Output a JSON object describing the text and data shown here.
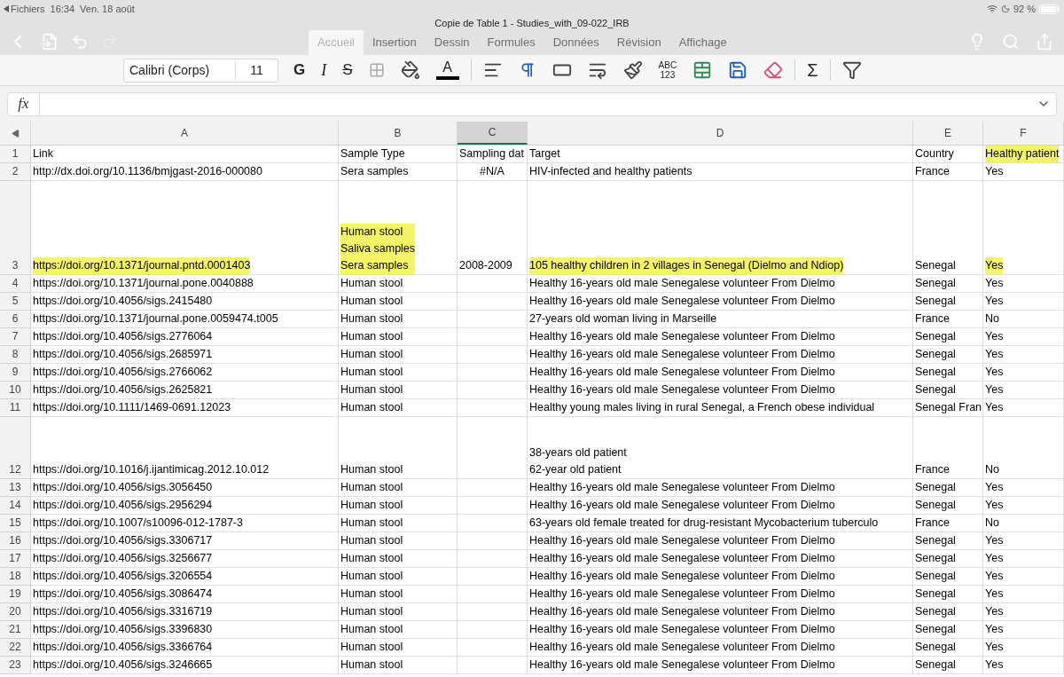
{
  "status_bar": {
    "back_label": "Fichiers",
    "time": "16:34",
    "date": "Ven. 18 août",
    "battery": "92 %"
  },
  "window": {
    "title": "Copie de Table 1 - Studies_with_09-022_IRB"
  },
  "tabs": [
    {
      "label": "Accueil",
      "selected": true
    },
    {
      "label": "Insertion",
      "selected": false
    },
    {
      "label": "Dessin",
      "selected": false
    },
    {
      "label": "Formules",
      "selected": false
    },
    {
      "label": "Données",
      "selected": false
    },
    {
      "label": "Révision",
      "selected": false
    },
    {
      "label": "Affichage",
      "selected": false
    }
  ],
  "toolbar": {
    "font": "Calibri (Corps)",
    "size": "11",
    "items": [
      {
        "kind": "bold",
        "label": "G"
      },
      {
        "kind": "italic",
        "label": "I"
      },
      {
        "kind": "strike",
        "label": "S"
      },
      {
        "kind": "borders"
      },
      {
        "kind": "fill"
      },
      {
        "kind": "font_color",
        "label": "A"
      },
      {
        "kind": "separator"
      },
      {
        "kind": "align"
      },
      {
        "kind": "direction"
      },
      {
        "kind": "merge"
      },
      {
        "kind": "wrap"
      },
      {
        "kind": "brush"
      },
      {
        "kind": "number_format",
        "lines": [
          "ABC",
          "123"
        ]
      },
      {
        "kind": "insert"
      },
      {
        "kind": "resize"
      },
      {
        "kind": "erase"
      },
      {
        "kind": "separator"
      },
      {
        "kind": "sum",
        "label": "Σ"
      },
      {
        "kind": "separator"
      },
      {
        "kind": "sort_filter"
      }
    ]
  },
  "formula_bar": {
    "label": "fx"
  },
  "columns": [
    {
      "label": "A",
      "selected": false
    },
    {
      "label": "B",
      "selected": false
    },
    {
      "label": "C",
      "selected": true
    },
    {
      "label": "D",
      "selected": false
    },
    {
      "label": "E",
      "selected": false
    },
    {
      "label": "F",
      "selected": false
    }
  ],
  "rows": [
    {
      "number": "1",
      "cells": [
        {
          "lines": [
            "Link"
          ],
          "highlighted": false
        },
        {
          "lines": [
            "Sample Type"
          ],
          "highlighted": false
        },
        {
          "lines": [
            "Sampling dat"
          ],
          "highlighted": false
        },
        {
          "lines": [
            "Target"
          ],
          "highlighted": false
        },
        {
          "lines": [
            "Country"
          ],
          "highlighted": false
        },
        {
          "lines": [
            "Healthy patient"
          ],
          "highlighted": true
        }
      ]
    },
    {
      "number": "2",
      "cells": [
        {
          "lines": [
            "http://dx.doi.org/10.1136/bmjgast-2016-000080"
          ],
          "highlighted": false
        },
        {
          "lines": [
            "Sera samples"
          ],
          "highlighted": false
        },
        {
          "lines": [
            "#N/A"
          ],
          "highlighted": false,
          "kind": "error"
        },
        {
          "lines": [
            "HIV-infected and healthy patients"
          ],
          "highlighted": false
        },
        {
          "lines": [
            "France"
          ],
          "highlighted": false
        },
        {
          "lines": [
            "Yes"
          ],
          "highlighted": false
        }
      ]
    },
    {
      "number": "3",
      "cells": [
        {
          "lines": [
            "https://doi.org/10.1371/journal.pntd.0001403"
          ],
          "highlighted": true
        },
        {
          "lines": [
            "Human stool",
            "Saliva samples",
            "Sera samples"
          ],
          "highlighted": true
        },
        {
          "lines": [
            "2008-2009"
          ],
          "highlighted": false
        },
        {
          "lines": [
            "105 healthy children in 2 villages in Senegal (Dielmo and Ndiop)"
          ],
          "highlighted": true
        },
        {
          "lines": [
            "Senegal"
          ],
          "highlighted": false
        },
        {
          "lines": [
            "Yes"
          ],
          "highlighted": true
        }
      ]
    },
    {
      "number": "4",
      "cells": [
        {
          "lines": [
            "https://doi.org/10.1371/journal.pone.0040888"
          ],
          "highlighted": false
        },
        {
          "lines": [
            "Human stool"
          ],
          "highlighted": false
        },
        {
          "kind": "empty"
        },
        {
          "lines": [
            "Healthy 16-years old male Senegalese volunteer From Dielmo"
          ],
          "highlighted": false
        },
        {
          "lines": [
            "Senegal"
          ],
          "highlighted": false
        },
        {
          "lines": [
            "Yes"
          ],
          "highlighted": false
        }
      ]
    },
    {
      "number": "5",
      "cells": [
        {
          "lines": [
            "https://doi.org/10.4056/sigs.2415480"
          ],
          "highlighted": false
        },
        {
          "lines": [
            "Human stool"
          ],
          "highlighted": false
        },
        {
          "kind": "empty"
        },
        {
          "lines": [
            "Healthy 16-years old male Senegalese volunteer From Dielmo"
          ],
          "highlighted": false
        },
        {
          "lines": [
            "Senegal"
          ],
          "highlighted": false
        },
        {
          "lines": [
            "Yes"
          ],
          "highlighted": false
        }
      ]
    },
    {
      "number": "6",
      "cells": [
        {
          "lines": [
            "https://doi.org/10.1371/journal.pone.0059474.t005"
          ],
          "highlighted": false
        },
        {
          "lines": [
            "Human stool"
          ],
          "highlighted": false
        },
        {
          "kind": "empty"
        },
        {
          "lines": [
            "27-years old woman living in Marseille"
          ],
          "highlighted": false
        },
        {
          "lines": [
            "France"
          ],
          "highlighted": false
        },
        {
          "lines": [
            "No"
          ],
          "highlighted": false
        }
      ]
    },
    {
      "number": "7",
      "cells": [
        {
          "lines": [
            "https://doi.org/10.4056/sigs.2776064"
          ],
          "highlighted": false
        },
        {
          "lines": [
            "Human stool"
          ],
          "highlighted": false
        },
        {
          "kind": "empty"
        },
        {
          "lines": [
            "Healthy 16-years old male Senegalese volunteer From Dielmo"
          ],
          "highlighted": false
        },
        {
          "lines": [
            "Senegal"
          ],
          "highlighted": false
        },
        {
          "lines": [
            "Yes"
          ],
          "highlighted": false
        }
      ]
    },
    {
      "number": "8",
      "cells": [
        {
          "lines": [
            "https://doi.org/10.4056/sigs.2685971"
          ],
          "highlighted": false
        },
        {
          "lines": [
            "Human stool"
          ],
          "highlighted": false
        },
        {
          "kind": "empty"
        },
        {
          "lines": [
            "Healthy 16-years old male Senegalese volunteer From Dielmo"
          ],
          "highlighted": false
        },
        {
          "lines": [
            "Senegal"
          ],
          "highlighted": false
        },
        {
          "lines": [
            "Yes"
          ],
          "highlighted": false
        }
      ]
    },
    {
      "number": "9",
      "cells": [
        {
          "lines": [
            "https://doi.org/10.4056/sigs.2766062"
          ],
          "highlighted": false
        },
        {
          "lines": [
            "Human stool"
          ],
          "highlighted": false
        },
        {
          "kind": "empty"
        },
        {
          "lines": [
            "Healthy 16-years old male Senegalese volunteer From Dielmo"
          ],
          "highlighted": false
        },
        {
          "lines": [
            "Senegal"
          ],
          "highlighted": false
        },
        {
          "lines": [
            "Yes"
          ],
          "highlighted": false
        }
      ]
    },
    {
      "number": "10",
      "cells": [
        {
          "lines": [
            "https://doi.org/10.4056/sigs.2625821"
          ],
          "highlighted": false
        },
        {
          "lines": [
            "Human stool"
          ],
          "highlighted": false
        },
        {
          "kind": "empty"
        },
        {
          "lines": [
            "Healthy 16-years old male Senegalese volunteer From Dielmo"
          ],
          "highlighted": false
        },
        {
          "lines": [
            "Senegal"
          ],
          "highlighted": false
        },
        {
          "lines": [
            "Yes"
          ],
          "highlighted": false
        }
      ]
    },
    {
      "number": "11",
      "cells": [
        {
          "lines": [
            "https://doi.org/10.1111/1469-0691.12023"
          ],
          "highlighted": false
        },
        {
          "lines": [
            "Human stool"
          ],
          "highlighted": false
        },
        {
          "kind": "empty"
        },
        {
          "lines": [
            "Healthy young males living in rural Senegal, a French obese individual"
          ],
          "highlighted": false
        },
        {
          "lines": [
            "Senegal Fran"
          ],
          "highlighted": false
        },
        {
          "lines": [
            "Yes"
          ],
          "highlighted": false
        }
      ]
    },
    {
      "number": "12",
      "cells": [
        {
          "lines": [
            "https://doi.org/10.1016/j.ijantimicag.2012.10.012"
          ],
          "highlighted": false
        },
        {
          "lines": [
            "Human stool"
          ],
          "highlighted": false
        },
        {
          "kind": "empty"
        },
        {
          "lines": [
            "38-years old patient",
            "62-year old patient"
          ],
          "highlighted": false
        },
        {
          "lines": [
            "France"
          ],
          "highlighted": false
        },
        {
          "lines": [
            "No"
          ],
          "highlighted": false
        }
      ]
    },
    {
      "number": "13",
      "cells": [
        {
          "lines": [
            "https://doi.org/10.4056/sigs.3056450"
          ],
          "highlighted": false
        },
        {
          "lines": [
            "Human stool"
          ],
          "highlighted": false
        },
        {
          "kind": "empty"
        },
        {
          "lines": [
            "Healthy 16-years old male Senegalese volunteer From Dielmo"
          ],
          "highlighted": false
        },
        {
          "lines": [
            "Senegal"
          ],
          "highlighted": false
        },
        {
          "lines": [
            "Yes"
          ],
          "highlighted": false
        }
      ]
    },
    {
      "number": "14",
      "cells": [
        {
          "lines": [
            "https://doi.org/10.4056/sigs.2956294"
          ],
          "highlighted": false
        },
        {
          "lines": [
            "Human stool"
          ],
          "highlighted": false
        },
        {
          "kind": "empty"
        },
        {
          "lines": [
            "Healthy 16-years old male Senegalese volunteer From Dielmo"
          ],
          "highlighted": false
        },
        {
          "lines": [
            "Senegal"
          ],
          "highlighted": false
        },
        {
          "lines": [
            "Yes"
          ],
          "highlighted": false
        }
      ]
    },
    {
      "number": "15",
      "cells": [
        {
          "lines": [
            "https://doi.org/10.1007/s10096-012-1787-3"
          ],
          "highlighted": false
        },
        {
          "lines": [
            "Human stool"
          ],
          "highlighted": false
        },
        {
          "kind": "empty"
        },
        {
          "lines": [
            "63-years old female treated for drug-resistant Mycobacterium tuberculo"
          ],
          "highlighted": false
        },
        {
          "lines": [
            "France"
          ],
          "highlighted": false
        },
        {
          "lines": [
            "No"
          ],
          "highlighted": false
        }
      ]
    },
    {
      "number": "16",
      "cells": [
        {
          "lines": [
            "https://doi.org/10.4056/sigs.3306717"
          ],
          "highlighted": false
        },
        {
          "lines": [
            "Human stool"
          ],
          "highlighted": false
        },
        {
          "kind": "empty"
        },
        {
          "lines": [
            "Healthy 16-years old male Senegalese volunteer From Dielmo"
          ],
          "highlighted": false
        },
        {
          "lines": [
            "Senegal"
          ],
          "highlighted": false
        },
        {
          "lines": [
            "Yes"
          ],
          "highlighted": false
        }
      ]
    },
    {
      "number": "17",
      "cells": [
        {
          "lines": [
            "https://doi.org/10.4056/sigs.3256677"
          ],
          "highlighted": false
        },
        {
          "lines": [
            "Human stool"
          ],
          "highlighted": false
        },
        {
          "kind": "empty"
        },
        {
          "lines": [
            "Healthy 16-years old male Senegalese volunteer From Dielmo"
          ],
          "highlighted": false
        },
        {
          "lines": [
            "Senegal"
          ],
          "highlighted": false
        },
        {
          "lines": [
            "Yes"
          ],
          "highlighted": false
        }
      ]
    },
    {
      "number": "18",
      "cells": [
        {
          "lines": [
            "https://doi.org/10.4056/sigs.3206554"
          ],
          "highlighted": false
        },
        {
          "lines": [
            "Human stool"
          ],
          "highlighted": false
        },
        {
          "kind": "empty"
        },
        {
          "lines": [
            "Healthy 16-years old male Senegalese volunteer From Dielmo"
          ],
          "highlighted": false
        },
        {
          "lines": [
            "Senegal"
          ],
          "highlighted": false
        },
        {
          "lines": [
            "Yes"
          ],
          "highlighted": false
        }
      ]
    },
    {
      "number": "19",
      "cells": [
        {
          "lines": [
            "https://doi.org/10.4056/sigs.3086474"
          ],
          "highlighted": false
        },
        {
          "lines": [
            "Human stool"
          ],
          "highlighted": false
        },
        {
          "kind": "empty"
        },
        {
          "lines": [
            "Healthy 16-years old male Senegalese volunteer From Dielmo"
          ],
          "highlighted": false
        },
        {
          "lines": [
            "Senegal"
          ],
          "highlighted": false
        },
        {
          "lines": [
            "Yes"
          ],
          "highlighted": false
        }
      ]
    },
    {
      "number": "20",
      "cells": [
        {
          "lines": [
            "https://doi.org/10.4056/sigs.3316719"
          ],
          "highlighted": false
        },
        {
          "lines": [
            "Human stool"
          ],
          "highlighted": false
        },
        {
          "kind": "empty"
        },
        {
          "lines": [
            "Healthy 16-years old male Senegalese volunteer From Dielmo"
          ],
          "highlighted": false
        },
        {
          "lines": [
            "Senegal"
          ],
          "highlighted": false
        },
        {
          "lines": [
            "Yes"
          ],
          "highlighted": false
        }
      ]
    },
    {
      "number": "21",
      "cells": [
        {
          "lines": [
            "https://doi.org/10.4056/sigs.3396830"
          ],
          "highlighted": false
        },
        {
          "lines": [
            "Human stool"
          ],
          "highlighted": false
        },
        {
          "kind": "empty"
        },
        {
          "lines": [
            "Healthy 16-years old male Senegalese volunteer From Dielmo"
          ],
          "highlighted": false
        },
        {
          "lines": [
            "Senegal"
          ],
          "highlighted": false
        },
        {
          "lines": [
            "Yes"
          ],
          "highlighted": false
        }
      ]
    },
    {
      "number": "22",
      "cells": [
        {
          "lines": [
            "https://doi.org/10.4056/sigs.3366764"
          ],
          "highlighted": false
        },
        {
          "lines": [
            "Human stool"
          ],
          "highlighted": false
        },
        {
          "kind": "empty"
        },
        {
          "lines": [
            "Healthy 16-years old male Senegalese volunteer From Dielmo"
          ],
          "highlighted": false
        },
        {
          "lines": [
            "Senegal"
          ],
          "highlighted": false
        },
        {
          "lines": [
            "Yes"
          ],
          "highlighted": false
        }
      ]
    },
    {
      "number": "23",
      "cells": [
        {
          "lines": [
            "https://doi.org/10.4056/sigs.3246665"
          ],
          "highlighted": false
        },
        {
          "lines": [
            "Human stool"
          ],
          "highlighted": false
        },
        {
          "kind": "empty"
        },
        {
          "lines": [
            "Healthy 16-years old male Senegalese volunteer From Dielmo"
          ],
          "highlighted": false
        },
        {
          "lines": [
            "Senegal"
          ],
          "highlighted": false
        },
        {
          "lines": [
            "Yes"
          ],
          "highlighted": false
        }
      ]
    }
  ]
}
